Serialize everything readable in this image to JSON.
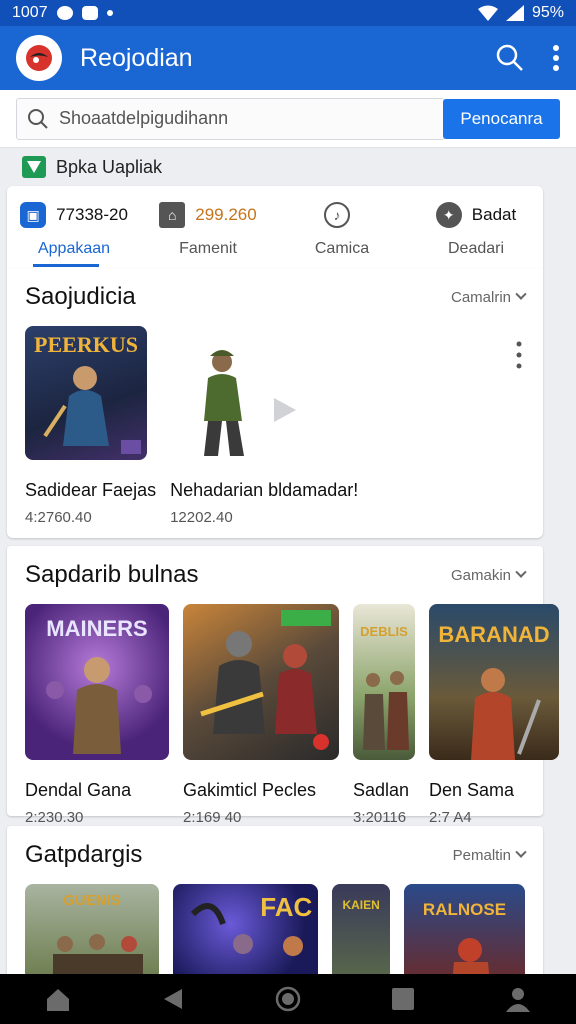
{
  "status": {
    "time": "1007",
    "battery": "95%"
  },
  "app": {
    "title": "Reojodian"
  },
  "search": {
    "placeholder": "Shoaatdelpigudihann",
    "button": "Penocanra"
  },
  "brand": {
    "label": "Bpka Uapliak"
  },
  "tabs": [
    {
      "value": "77338-20",
      "label": "Appakaan"
    },
    {
      "value": "299.260",
      "label": "Famenit"
    },
    {
      "value": "",
      "label": "Camica"
    },
    {
      "value": "Badat",
      "label": "Deadari"
    }
  ],
  "sections": [
    {
      "title": "Saojudicia",
      "more": "Camalrin",
      "items": [
        {
          "name": "Sadidear Faejas",
          "size": "4:2760.40"
        },
        {
          "name": "Nehadarian bldamadar!",
          "size": "12202.40"
        }
      ]
    },
    {
      "title": "Sapdarib bulnas",
      "more": "Gamakin",
      "items": [
        {
          "name": "Dendal Gana",
          "size": "2:230.30"
        },
        {
          "name": "Gakimticl Pecles",
          "size": "2:169 40"
        },
        {
          "name": "Sadlan",
          "size": "3:20116"
        },
        {
          "name": "Den Sama",
          "size": "2:7 A4"
        }
      ]
    },
    {
      "title": "Gatpdargis",
      "more": "Pemaltin",
      "items": []
    }
  ],
  "art_text": {
    "s1_i1": "PEERKUS",
    "s2_i1": "MAINERS",
    "s2_i3": "DEBLIS",
    "s2_i4": "BARANAD",
    "s3_i1": "GUENIS",
    "s3_i2": "FAC",
    "s3_i3": "KAIEN",
    "s3_i4": "RALNOSE"
  },
  "colors": {
    "statusbar": "#1150b8",
    "appbar": "#1a66d2",
    "accent": "#1a73e8"
  }
}
